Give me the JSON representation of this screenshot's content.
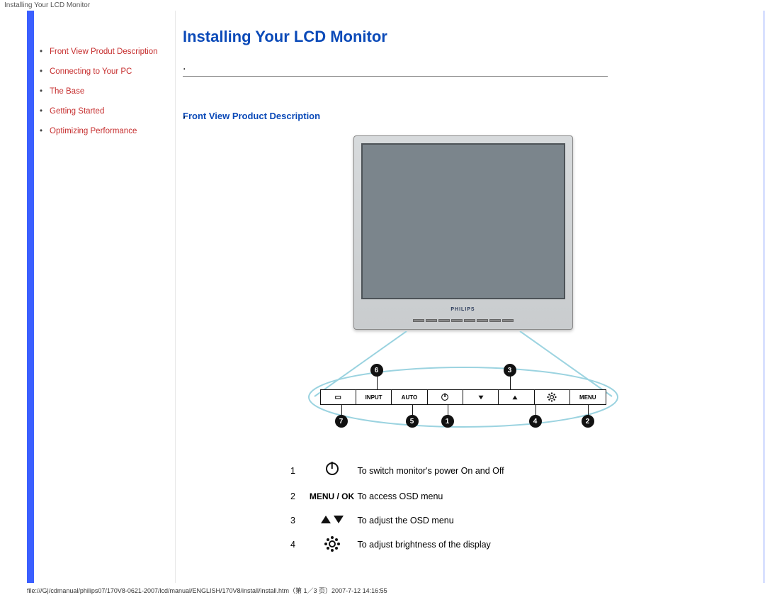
{
  "top_label": "Installing Your LCD Monitor",
  "sidebar": {
    "items": [
      {
        "label": "Front View Produt Description"
      },
      {
        "label": "Connecting to Your PC"
      },
      {
        "label": "The Base"
      },
      {
        "label": "Getting Started"
      },
      {
        "label": "Optimizing Performance"
      }
    ]
  },
  "page_title": "Installing Your LCD Monitor",
  "section_title": "Front View Product Description",
  "monitor_brand": "PHILIPS",
  "controls": {
    "buttons": [
      "",
      "INPUT",
      "AUTO",
      "",
      "",
      "",
      "",
      "MENU"
    ],
    "callouts_top": [
      "6",
      "3"
    ],
    "callouts_bottom": [
      "7",
      "5",
      "1",
      "4",
      "2"
    ]
  },
  "legend": [
    {
      "num": "1",
      "icon": "power",
      "text": "To switch monitor's power On and Off"
    },
    {
      "num": "2",
      "icon": "menu",
      "text": "To access OSD menu",
      "menu_label": "MENU / OK"
    },
    {
      "num": "3",
      "icon": "arrows",
      "text": "To adjust the OSD menu"
    },
    {
      "num": "4",
      "icon": "bright",
      "text": "To adjust brightness of the display"
    }
  ],
  "footer_path": "file:///G|/cdmanual/philips07/170V8-0621-2007/lcd/manual/ENGLISH/170V8/install/install.htm（第 1／3 页）2007-7-12 14:16:55"
}
